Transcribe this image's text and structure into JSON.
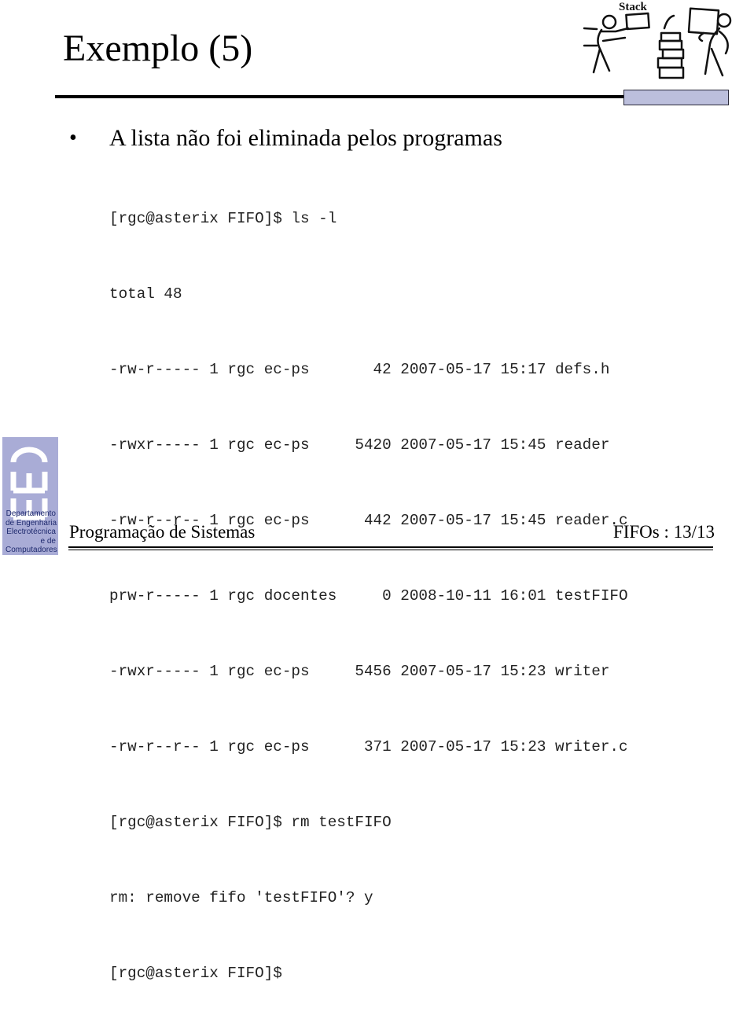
{
  "slide": {
    "title": "Exemplo (5)",
    "bullet_symbol": "•",
    "bullet_text": "A lista não foi eliminada pelos programas"
  },
  "terminal": {
    "lines": [
      "[rgc@asterix FIFO]$ ls -l",
      "total 48",
      "-rw-r----- 1 rgc ec-ps       42 2007-05-17 15:17 defs.h",
      "-rwxr----- 1 rgc ec-ps     5420 2007-05-17 15:45 reader",
      "-rw-r--r-- 1 rgc ec-ps      442 2007-05-17 15:45 reader.c",
      "prw-r----- 1 rgc docentes     0 2008-10-11 16:01 testFIFO",
      "-rwxr----- 1 rgc ec-ps     5456 2007-05-17 15:23 writer",
      "-rw-r--r-- 1 rgc ec-ps      371 2007-05-17 15:23 writer.c",
      "[rgc@asterix FIFO]$ rm testFIFO",
      "rm: remove fifo 'testFIFO'? y",
      "[rgc@asterix FIFO]$"
    ]
  },
  "clipart": {
    "label": "Stack",
    "icon": "stack-clipart-icon"
  },
  "logo": {
    "letters": "DEEC",
    "lines": [
      "Departamento",
      "de Engenharia",
      "Electrotécnica",
      "e de",
      "Computadores"
    ],
    "color": "#a9acd6"
  },
  "footer": {
    "left": "Programação de Sistemas",
    "right": "FIFOs : 13/13"
  },
  "colors": {
    "header_box": "#bcbfdc",
    "logo_text": "#1f2a6e"
  }
}
